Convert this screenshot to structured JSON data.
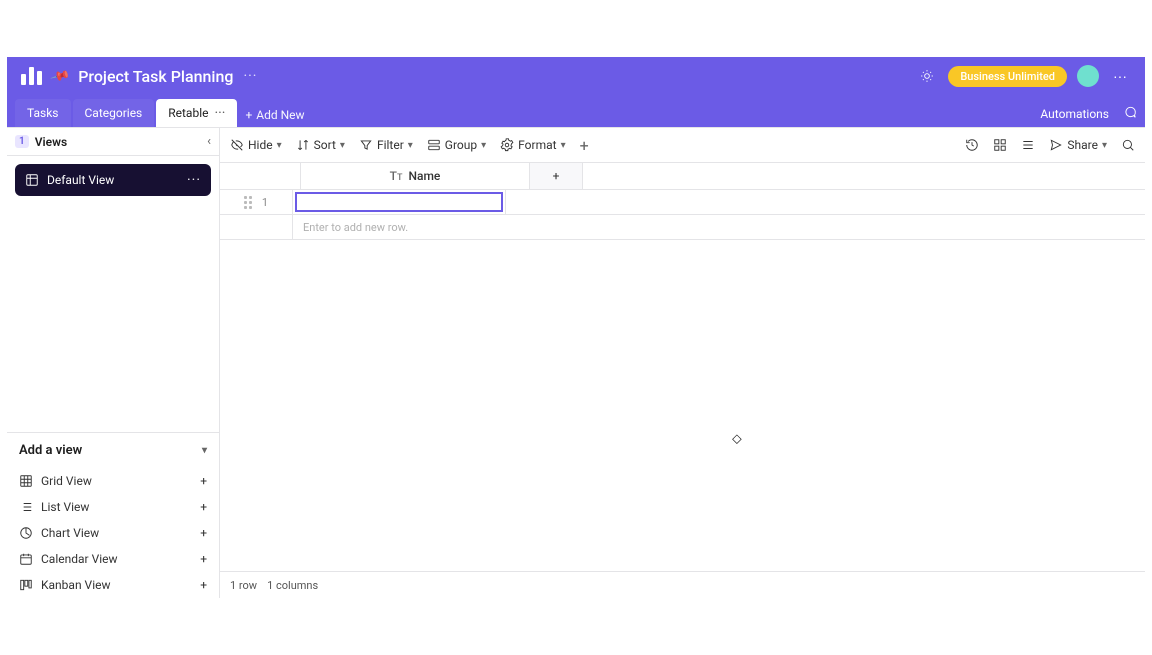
{
  "header": {
    "project_title": "Project Task Planning",
    "badge": "Business Unlimited",
    "avatar_initials": ""
  },
  "tabs": {
    "items": [
      {
        "label": "Tasks"
      },
      {
        "label": "Categories"
      },
      {
        "label": "Retable"
      }
    ],
    "add_new_label": "Add New",
    "automations_label": "Automations"
  },
  "sidebar": {
    "views_label": "Views",
    "views_count": "1",
    "active_view_label": "Default View",
    "add_view_header": "Add a view",
    "view_types": [
      {
        "label": "Grid View",
        "icon": "grid"
      },
      {
        "label": "List View",
        "icon": "list"
      },
      {
        "label": "Chart View",
        "icon": "chart"
      },
      {
        "label": "Calendar View",
        "icon": "calendar"
      },
      {
        "label": "Kanban View",
        "icon": "kanban"
      }
    ]
  },
  "toolbar": {
    "hide": "Hide",
    "sort": "Sort",
    "filter": "Filter",
    "group": "Group",
    "format": "Format",
    "share": "Share"
  },
  "grid": {
    "column_name": "Name",
    "row1_number": "1",
    "row1_value": "",
    "addrow_hint": "Enter to add new row.",
    "status_rows": "1 row",
    "status_cols": "1 columns"
  }
}
